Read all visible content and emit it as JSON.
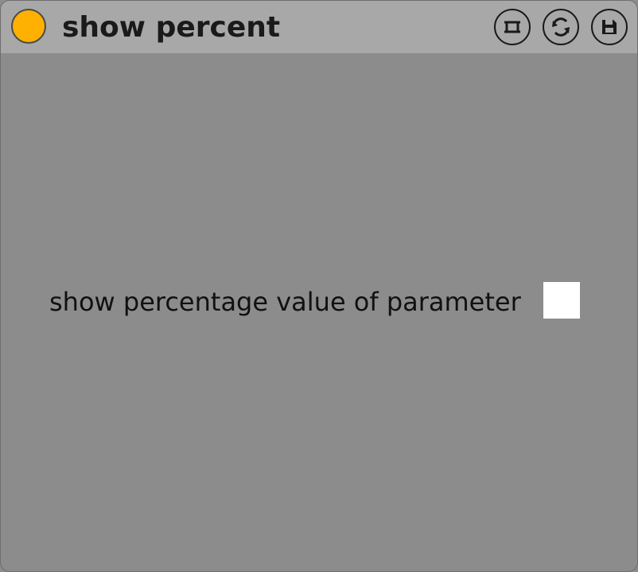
{
  "device": {
    "title": "show percent",
    "power_color": "#ffb000",
    "buttons": [
      {
        "name": "pin-icon"
      },
      {
        "name": "swap-icon"
      },
      {
        "name": "save-icon"
      }
    ]
  },
  "options": {
    "show_percentage_label": "show percentage value of parameter",
    "show_percentage_checked": false
  },
  "colors": {
    "background": "#8c8c8c",
    "titlebar": "#a8a8a8",
    "accent": "#ffb000",
    "checkbox": "#ffffff"
  }
}
